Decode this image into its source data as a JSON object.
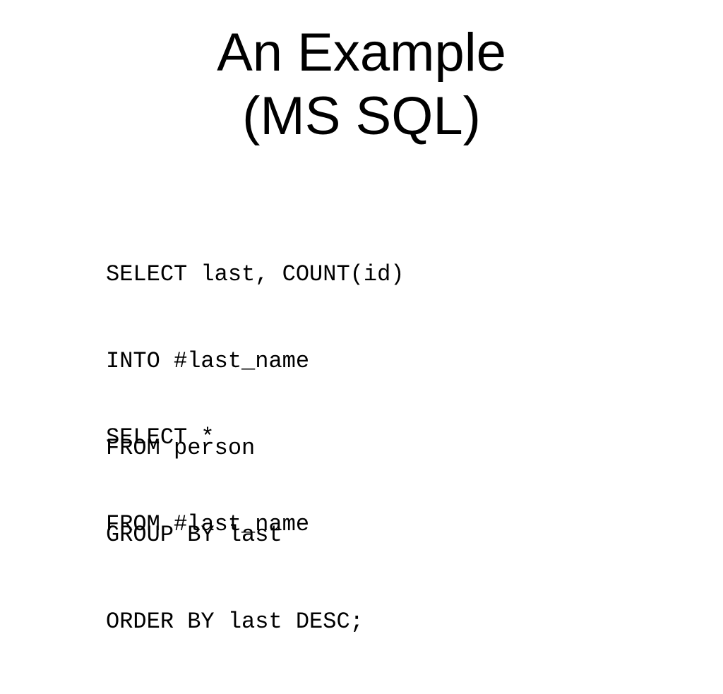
{
  "slide": {
    "title_lines": [
      "An Example",
      "(MS SQL)"
    ],
    "code_blocks": [
      {
        "lines": [
          "SELECT last, COUNT(id)",
          "INTO #last_name",
          "FROM person",
          "GROUP BY last",
          "ORDER BY last DESC;"
        ]
      },
      {
        "lines": [
          "SELECT *",
          "FROM #last_name"
        ]
      }
    ]
  },
  "colors": {
    "background": "#ffffff",
    "text": "#000000"
  }
}
